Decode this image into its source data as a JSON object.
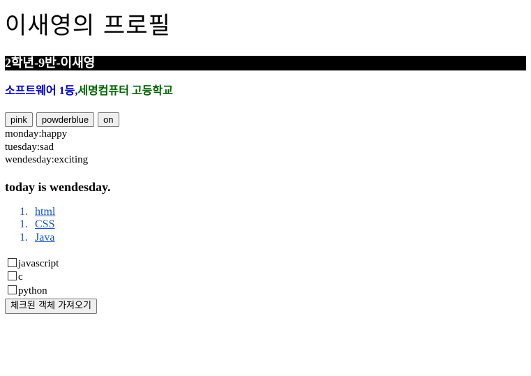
{
  "page": {
    "title": "이새영의 프로필",
    "banner": "2학년-9반-이새영",
    "school": {
      "part1": "소프트웨어 1등,",
      "part2": "세명컴퓨터 고등학교"
    },
    "buttons": {
      "pink": "pink",
      "powderblue": "powderblue",
      "on": "on"
    },
    "days": [
      "monday:happy",
      "tuesday:sad",
      "wendesday:exciting"
    ],
    "today": "today is wendesday.",
    "links": [
      {
        "num": "1.",
        "label": "html"
      },
      {
        "num": "1.",
        "label": "CSS"
      },
      {
        "num": "1.",
        "label": "Java"
      }
    ],
    "checkboxes": [
      {
        "label": "javascript",
        "checked": false
      },
      {
        "label": "c",
        "checked": false
      },
      {
        "label": "python",
        "checked": false
      }
    ],
    "get_checked_button": "체크된 객체 가져오기"
  },
  "colors": {
    "banner_bg": "#000000",
    "banner_text": "#ffffff",
    "school_blue": "#0000c8",
    "school_green": "#006400",
    "link": "#1a55c8"
  }
}
